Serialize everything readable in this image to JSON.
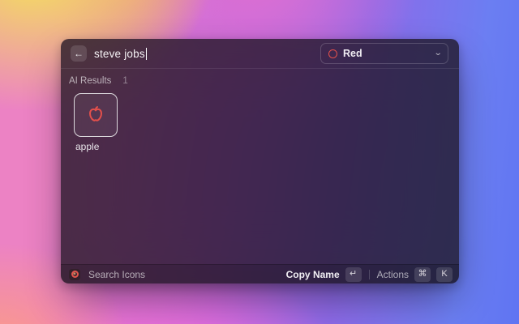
{
  "colors": {
    "accent": "#e4504b"
  },
  "window": {
    "search": {
      "value": "steve jobs",
      "back_icon": "←"
    },
    "dropdown": {
      "label": "Red",
      "chevron_icon": "⌄"
    },
    "results": {
      "section": "AI Results",
      "count": "1",
      "items": [
        {
          "name": "apple",
          "icon": "apple-outline"
        }
      ]
    },
    "footer": {
      "app_label": "Search Icons",
      "primary_action": "Copy Name",
      "primary_key": "↵",
      "secondary_action": "Actions",
      "keys": [
        "⌘",
        "K"
      ]
    }
  }
}
